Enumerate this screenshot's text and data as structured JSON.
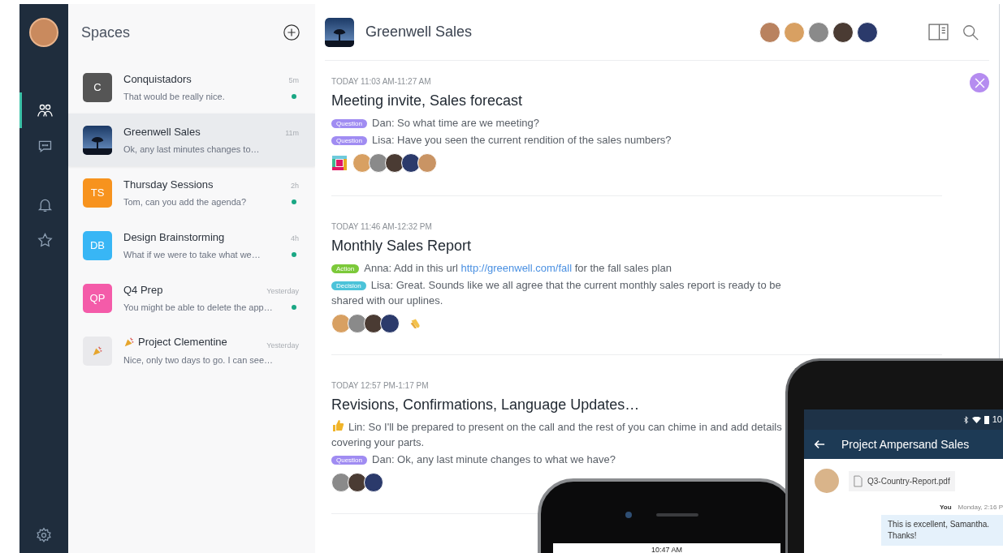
{
  "rail": {
    "items": [
      {
        "kind": "people",
        "selected": true
      },
      {
        "kind": "chat",
        "selected": false
      },
      {
        "kind": "bell",
        "selected": false
      },
      {
        "kind": "star",
        "selected": false
      }
    ]
  },
  "spaces": {
    "title": "Spaces",
    "items": [
      {
        "kind": "initials",
        "initials": "C",
        "color": "#555555",
        "name": "Conquistadors",
        "preview": "That would be really nice.",
        "time": "5m",
        "unread": true,
        "selected": false
      },
      {
        "kind": "photo",
        "name": "Greenwell Sales",
        "preview": "Ok, any last minutes changes to…",
        "time": "11m",
        "unread": false,
        "selected": true
      },
      {
        "kind": "initials",
        "initials": "TS",
        "color": "#f7931e",
        "name": "Thursday Sessions",
        "preview": "Tom, can you add the agenda?",
        "time": "2h",
        "unread": true,
        "selected": false
      },
      {
        "kind": "initials",
        "initials": "DB",
        "color": "#38b6f5",
        "name": "Design Brainstorming",
        "preview": "What if we were to take what we…",
        "time": "4h",
        "unread": true,
        "selected": false
      },
      {
        "kind": "initials",
        "initials": "QP",
        "color": "#f45ba9",
        "name": "Q4 Prep",
        "preview": "You might be able to delete the app…",
        "time": "Yesterday",
        "unread": true,
        "selected": false
      },
      {
        "kind": "party",
        "name": "Project Clementine",
        "preview": "Nice, only two days to go.  I can see…",
        "time": "Yesterday",
        "unread": false,
        "selected": false
      }
    ]
  },
  "header": {
    "title": "Greenwell Sales"
  },
  "conversations": [
    {
      "time": "TODAY  11:03 AM-11:27 AM",
      "title": "Meeting invite, Sales forecast",
      "messages": [
        {
          "tag": {
            "label": "Question",
            "kind": "question"
          },
          "text": "Dan: So what time are we meeting?"
        },
        {
          "tag": {
            "label": "Question",
            "kind": "question"
          },
          "text": "Lisa: Have you seen the current rendition of the sales numbers?"
        }
      ],
      "reactions": [
        {
          "kind": "app"
        },
        {
          "kind": "avatar"
        },
        {
          "kind": "avatar"
        },
        {
          "kind": "avatar"
        },
        {
          "kind": "avatar"
        },
        {
          "kind": "avatar"
        }
      ]
    },
    {
      "time": "TODAY 11:46 AM-12:32 PM",
      "title": "Monthly Sales Report",
      "messages": [
        {
          "tag": {
            "label": "Action",
            "kind": "action"
          },
          "text": "Anna: Add in this url ",
          "link": "http://greenwell.com/fall",
          "after": " for the fall sales plan"
        },
        {
          "tag": {
            "label": "Decision",
            "kind": "decision"
          },
          "text": "Lisa: Great. Sounds like we all agree that the current monthly sales report is ready to be shared with our uplines."
        }
      ],
      "reactions": [
        {
          "kind": "avatar"
        },
        {
          "kind": "avatar"
        },
        {
          "kind": "avatar"
        },
        {
          "kind": "avatar"
        },
        {
          "kind": "clap"
        }
      ]
    },
    {
      "time": "TODAY 12:57 PM-1:17 PM",
      "title": "Revisions, Confirmations, Language Updates…",
      "messages": [
        {
          "kind": "thumbs_up",
          "text": "Lin: So I'll be prepared to present on the call and the rest of you can chime in and add details covering your parts."
        },
        {
          "tag": {
            "label": "Question",
            "kind": "question"
          },
          "text": "Dan: Ok, any last minute changes to what we have?"
        }
      ],
      "reactions": [
        {
          "kind": "avatar"
        },
        {
          "kind": "avatar"
        },
        {
          "kind": "avatar"
        }
      ]
    }
  ],
  "iphone": {
    "time": "10:47 AM"
  },
  "android": {
    "status_time": "10",
    "title": "Project Ampersand Sales",
    "file": "Q3-Country-Report.pdf",
    "message": {
      "sender": "You",
      "time": "Monday, 2:16 P",
      "text": "This is excellent, Samantha. Thanks!"
    }
  }
}
